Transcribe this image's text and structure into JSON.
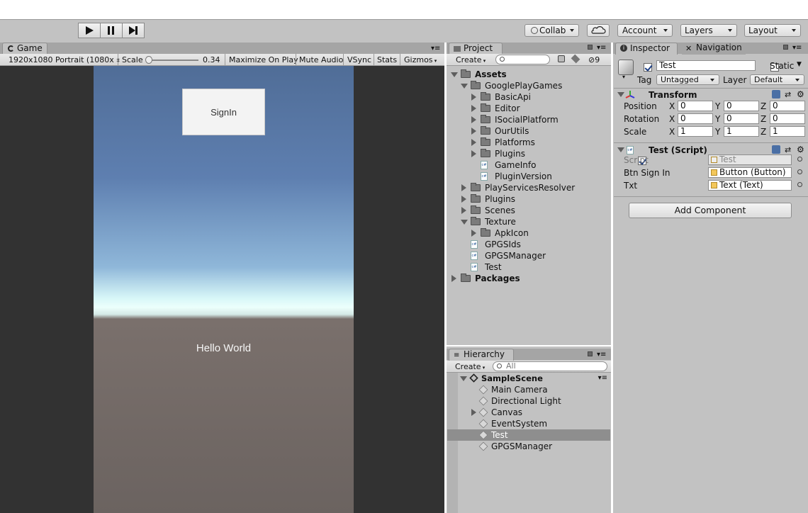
{
  "toolbar": {
    "collab": "Collab",
    "account": "Account",
    "layers": "Layers",
    "layout": "Layout"
  },
  "game": {
    "tab": "Game",
    "resolution": "1920x1080 Portrait (1080x",
    "scale_label": "Scale",
    "scale_value": "0.34",
    "maximize": "Maximize On Play",
    "mute": "Mute Audio",
    "vsync": "VSync",
    "stats": "Stats",
    "gizmos": "Gizmos",
    "signin_button": "SignIn",
    "hello_text": "Hello World"
  },
  "project": {
    "tab": "Project",
    "create": "Create",
    "hidden_count": "9",
    "tree": [
      {
        "label": "Assets",
        "indent": 0,
        "type": "folder",
        "expanded": true,
        "bold": true
      },
      {
        "label": "GooglePlayGames",
        "indent": 1,
        "type": "folder",
        "expanded": true
      },
      {
        "label": "BasicApi",
        "indent": 2,
        "type": "folder",
        "expanded": false
      },
      {
        "label": "Editor",
        "indent": 2,
        "type": "folder",
        "expanded": false
      },
      {
        "label": "ISocialPlatform",
        "indent": 2,
        "type": "folder",
        "expanded": false
      },
      {
        "label": "OurUtils",
        "indent": 2,
        "type": "folder",
        "expanded": false
      },
      {
        "label": "Platforms",
        "indent": 2,
        "type": "folder",
        "expanded": false
      },
      {
        "label": "Plugins",
        "indent": 2,
        "type": "folder",
        "expanded": false
      },
      {
        "label": "GameInfo",
        "indent": 2,
        "type": "script"
      },
      {
        "label": "PluginVersion",
        "indent": 2,
        "type": "script"
      },
      {
        "label": "PlayServicesResolver",
        "indent": 1,
        "type": "folder",
        "expanded": false
      },
      {
        "label": "Plugins",
        "indent": 1,
        "type": "folder",
        "expanded": false
      },
      {
        "label": "Scenes",
        "indent": 1,
        "type": "folder",
        "expanded": false
      },
      {
        "label": "Texture",
        "indent": 1,
        "type": "folder",
        "expanded": true
      },
      {
        "label": "ApkIcon",
        "indent": 2,
        "type": "folder",
        "expanded": false
      },
      {
        "label": "GPGSIds",
        "indent": 1,
        "type": "script"
      },
      {
        "label": "GPGSManager",
        "indent": 1,
        "type": "script"
      },
      {
        "label": "Test",
        "indent": 1,
        "type": "script"
      },
      {
        "label": "Packages",
        "indent": 0,
        "type": "folder",
        "expanded": false,
        "bold": true
      }
    ]
  },
  "hierarchy": {
    "tab": "Hierarchy",
    "create": "Create",
    "search_placeholder": "All",
    "scene": "SampleScene",
    "items": [
      {
        "label": "Main Camera",
        "expandable": false,
        "selected": false
      },
      {
        "label": "Directional Light",
        "expandable": false,
        "selected": false
      },
      {
        "label": "Canvas",
        "expandable": true,
        "selected": false
      },
      {
        "label": "EventSystem",
        "expandable": false,
        "selected": false
      },
      {
        "label": "Test",
        "expandable": false,
        "selected": true
      },
      {
        "label": "GPGSManager",
        "expandable": false,
        "selected": false
      }
    ]
  },
  "inspector": {
    "tab": "Inspector",
    "nav_tab": "Navigation",
    "object_name": "Test",
    "static_label": "Static",
    "tag_label": "Tag",
    "tag_value": "Untagged",
    "layer_label": "Layer",
    "layer_value": "Default",
    "transform": {
      "title": "Transform",
      "rows": [
        {
          "label": "Position",
          "x": "0",
          "y": "0",
          "z": "0"
        },
        {
          "label": "Rotation",
          "x": "0",
          "y": "0",
          "z": "0"
        },
        {
          "label": "Scale",
          "x": "1",
          "y": "1",
          "z": "1"
        }
      ],
      "axis_x": "X",
      "axis_y": "Y",
      "axis_z": "Z"
    },
    "script": {
      "title": "Test (Script)",
      "rows": [
        {
          "label": "Script",
          "value": "Test",
          "readonly": true
        },
        {
          "label": "Btn Sign In",
          "value": "Button (Button)",
          "readonly": false
        },
        {
          "label": "Txt",
          "value": "Text (Text)",
          "readonly": false
        }
      ]
    },
    "add_component": "Add Component"
  }
}
